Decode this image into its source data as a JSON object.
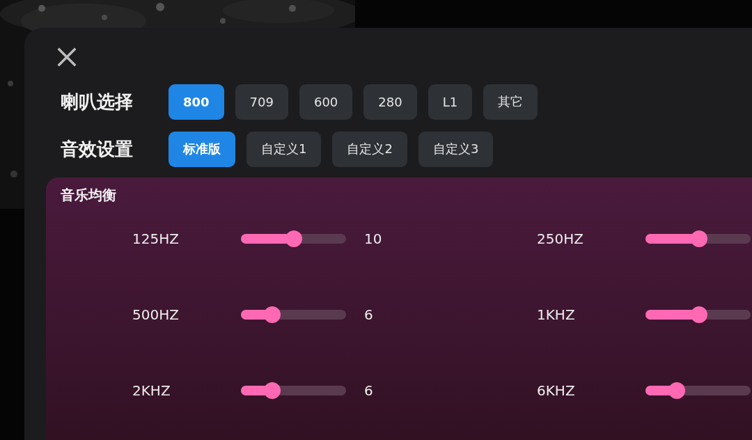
{
  "speaker_select": {
    "label": "喇叭选择",
    "options": [
      {
        "label": "800",
        "selected": true
      },
      {
        "label": "709",
        "selected": false
      },
      {
        "label": "600",
        "selected": false
      },
      {
        "label": "280",
        "selected": false
      },
      {
        "label": "L1",
        "selected": false
      },
      {
        "label": "其它",
        "selected": false
      }
    ]
  },
  "sound_settings": {
    "label": "音效设置",
    "options": [
      {
        "label": "标准版",
        "selected": true
      },
      {
        "label": "自定义1",
        "selected": false
      },
      {
        "label": "自定义2",
        "selected": false
      },
      {
        "label": "自定义3",
        "selected": false
      }
    ]
  },
  "equalizer": {
    "title": "音乐均衡",
    "bands": [
      {
        "label": "125HZ",
        "level": 0.5,
        "value": "10"
      },
      {
        "label": "250HZ",
        "level": 0.51
      },
      {
        "label": "500HZ",
        "level": 0.3,
        "value": "6"
      },
      {
        "label": "1KHZ",
        "level": 0.51
      },
      {
        "label": "2KHZ",
        "level": 0.3,
        "value": "6"
      },
      {
        "label": "6KHZ",
        "level": 0.3
      }
    ]
  }
}
